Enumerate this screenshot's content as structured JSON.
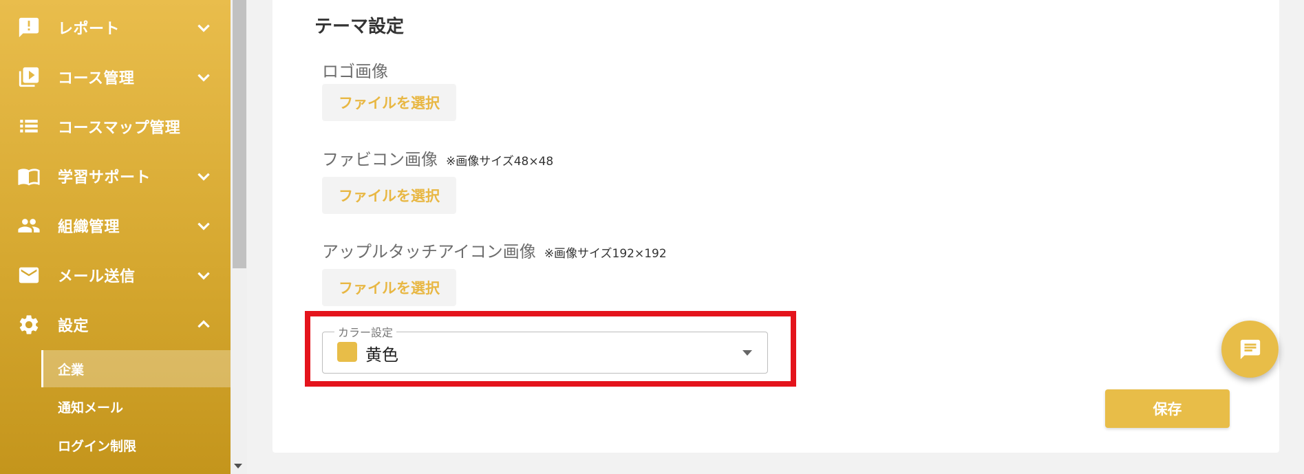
{
  "sidebar": {
    "items": [
      {
        "label": "レポート",
        "icon": "report-icon",
        "expanded": false
      },
      {
        "label": "コース管理",
        "icon": "play-library-icon",
        "expanded": false
      },
      {
        "label": "コースマップ管理",
        "icon": "list-icon"
      },
      {
        "label": "学習サポート",
        "icon": "book-icon",
        "expanded": false
      },
      {
        "label": "組織管理",
        "icon": "people-icon",
        "expanded": false
      },
      {
        "label": "メール送信",
        "icon": "mail-icon",
        "expanded": false
      },
      {
        "label": "設定",
        "icon": "gear-icon",
        "expanded": true
      }
    ],
    "settings_sub": [
      {
        "label": "企業",
        "active": true
      },
      {
        "label": "通知メール",
        "active": false
      },
      {
        "label": "ログイン制限",
        "active": false
      }
    ]
  },
  "theme": {
    "title": "テーマ設定",
    "logo": {
      "label": "ロゴ画像",
      "button": "ファイルを選択"
    },
    "favicon": {
      "label": "ファビコン画像",
      "note": "※画像サイズ48×48",
      "button": "ファイルを選択"
    },
    "touch_icon": {
      "label": "アップルタッチアイコン画像",
      "note": "※画像サイズ192×192",
      "button": "ファイルを選択"
    },
    "color": {
      "label": "カラー設定",
      "value": "黄色",
      "swatch": "#e8bd48"
    }
  },
  "actions": {
    "save": "保存"
  },
  "colors": {
    "accent": "#e8bd48",
    "highlight": "#e4141c"
  }
}
